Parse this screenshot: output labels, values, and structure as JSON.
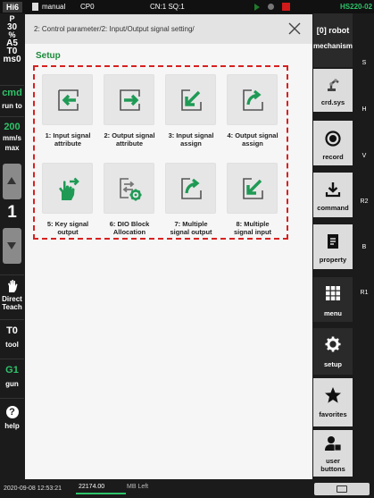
{
  "topbar": {
    "logo": "Hi6",
    "mode": "manual",
    "program": "CP0",
    "cn_sq": "CN:1 SQ:1",
    "controller": "HS220-02"
  },
  "leftbar": {
    "status": [
      "P",
      "30",
      "%",
      "A5",
      "T0",
      "ms0"
    ],
    "cmd": "cmd",
    "run_to": "run to",
    "speed": "200",
    "speed_unit_1": "mm/s",
    "speed_unit_2": "max",
    "step": "1",
    "direct_teach_1": "Direct",
    "direct_teach_2": "Teach",
    "tool_value": "T0",
    "tool_label": "tool",
    "gun_value": "G1",
    "gun_label": "gun",
    "help_label": "help"
  },
  "panel": {
    "breadcrumb": "2: Control parameter/2: Input/Output signal setting/",
    "section_title": "Setup",
    "tiles": [
      {
        "line1": "1: Input signal",
        "line2": "attribute",
        "icon": "arrow-left-into-box-icon"
      },
      {
        "line1": "2: Output signal",
        "line2": "attribute",
        "icon": "arrow-right-out-box-icon"
      },
      {
        "line1": "3: Input signal",
        "line2": "assign",
        "icon": "arrow-down-left-into-box-icon"
      },
      {
        "line1": "4: Output signal",
        "line2": "assign",
        "icon": "arrow-up-right-out-box-icon"
      },
      {
        "line1": "5: Key signal",
        "line2": "output",
        "icon": "touch-hand-arrow-icon"
      },
      {
        "line1": "6: DIO Block",
        "line2": "Allocation",
        "icon": "dio-gear-icon"
      },
      {
        "line1": "7: Multiple",
        "line2": "signal output",
        "icon": "arrow-up-right-out-box-icon"
      },
      {
        "line1": "8: Multiple",
        "line2": "signal input",
        "icon": "arrow-down-left-into-box-icon"
      }
    ]
  },
  "rightbar": {
    "robot_1": "[0] robot",
    "robot_2": "mechanism",
    "crd": "crd.sys",
    "record": "record",
    "command": "command",
    "property": "property",
    "menu": "menu",
    "setup": "setup",
    "favorites": "favorites",
    "user_buttons_1": "user",
    "user_buttons_2": "buttons",
    "side_labels": [
      "S",
      "H",
      "V",
      "R2",
      "B",
      "R1"
    ]
  },
  "bottombar": {
    "datetime": "2020-09-08 12:53:21",
    "memory": "22174.00",
    "memory_unit": "MB Left"
  },
  "colors": {
    "accent_green": "#1a8a3a",
    "highlight_red": "#d82020",
    "status_green": "#2ec36a"
  }
}
